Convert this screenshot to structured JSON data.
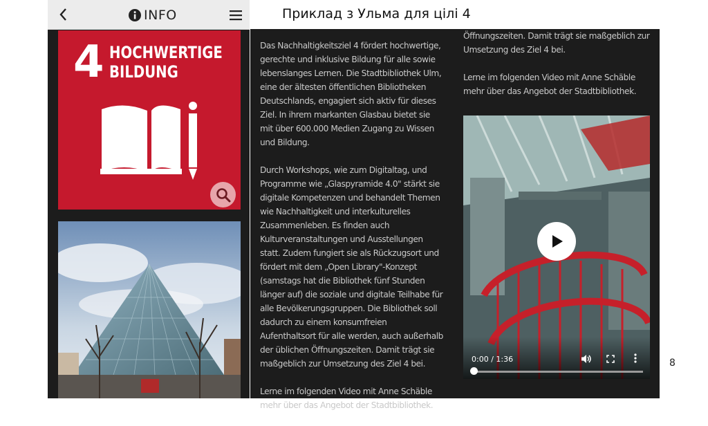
{
  "header": {
    "title": "INFO",
    "back_icon": "chevron-left-icon",
    "info_icon": "info-circle-icon",
    "menu_icon": "hamburger-menu-icon"
  },
  "slide": {
    "title": "Приклад з Ульма для цілі 4",
    "page_number": "8"
  },
  "sdg": {
    "number": "4",
    "title_line1": "HOCHWERTIGE",
    "title_line2": "BILDUNG",
    "color": "#c5192d",
    "icon": "book-pencil-icon",
    "zoom_icon": "magnifier-icon"
  },
  "article": {
    "col1": [
      "Das Nachhaltigkeitsziel 4 fördert hochwertige, gerechte und inklusive Bildung für alle sowie lebenslanges Lernen. Die Stadtbibliothek Ulm, eine der ältesten öffentlichen Bibliotheken Deutschlands, engagiert sich aktiv für dieses Ziel. In ihrem markanten Glasbau bietet sie mit über 600.000 Medien Zugang zu Wissen und Bildung.",
      "Durch Workshops, wie zum Digitaltag, und Programme wie „Glaspyramide 4.0\" stärkt sie digitale Kompetenzen und behandelt Themen wie Nachhaltigkeit und interkulturelles Zusammenleben. Es finden auch Kulturveranstaltungen und Ausstellungen statt. Zudem fungiert sie als Rückzugsort und fördert mit dem „Open Library\"-Konzept (samstags hat die Bibliothek fünf Stunden länger auf) die soziale und digitale Teilhabe für alle Bevölkerungsgruppen. Die Bibliothek soll dadurch zu einem konsumfreien Aufenthaltsort für alle werden, auch außerhalb der üblichen Öffnungszeiten. Damit trägt sie maßgeblich zur Umsetzung des Ziel 4 bei.",
      "Lerne im folgenden Video mit Anne Schäble mehr über das Angebot der Stadtbibliothek."
    ],
    "col2": [
      "Öffnungszeiten. Damit trägt sie maßgeblich zur Umsetzung des Ziel 4 bei.",
      "Lerne im folgenden Video mit Anne Schäble mehr über das Angebot der Stadtbibliothek."
    ]
  },
  "video": {
    "time": "0:00 / 1:36",
    "progress": 0,
    "play_icon": "play-icon",
    "volume_icon": "volume-icon",
    "fullscreen_icon": "fullscreen-icon",
    "more_icon": "more-vertical-icon"
  }
}
